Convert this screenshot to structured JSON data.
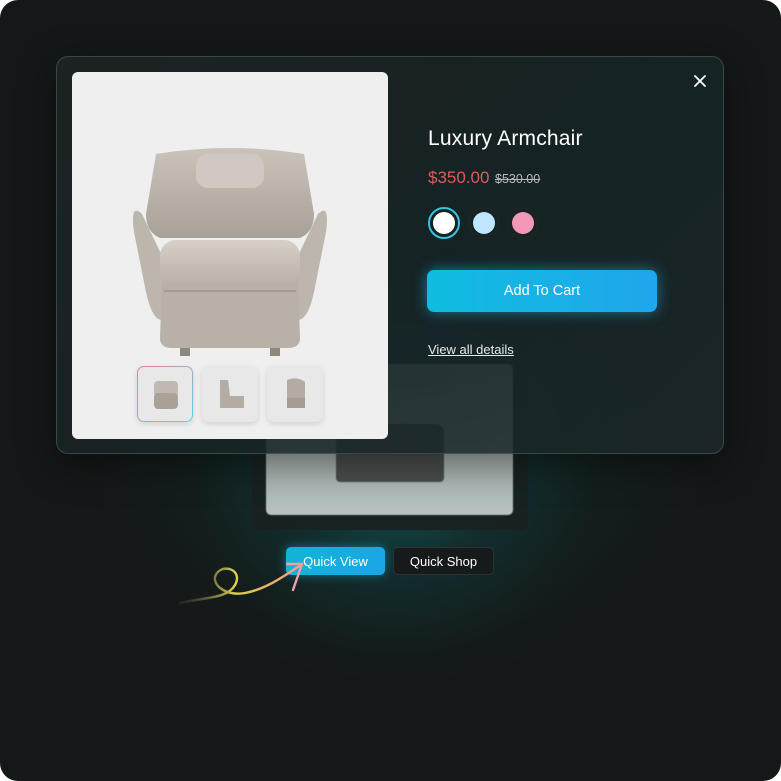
{
  "product": {
    "title": "Luxury Armchair",
    "price": "$350.00",
    "old_price": "$530.00",
    "swatches": [
      {
        "name": "white",
        "color": "#ffffff",
        "selected": true
      },
      {
        "name": "light-blue",
        "color": "#bfe6ff",
        "selected": false
      },
      {
        "name": "pink",
        "color": "#f598b8",
        "selected": false
      }
    ],
    "add_to_cart_label": "Add To Cart",
    "details_link": "View all details",
    "thumbnails": [
      "front",
      "side",
      "back"
    ]
  },
  "modal": {
    "close_icon": "close-icon"
  },
  "card": {
    "quick_view_label": "Quick View",
    "quick_shop_label": "Quick Shop"
  },
  "colors": {
    "accent": "#12b4d8",
    "price": "#e05a5a",
    "background": "#151818"
  }
}
